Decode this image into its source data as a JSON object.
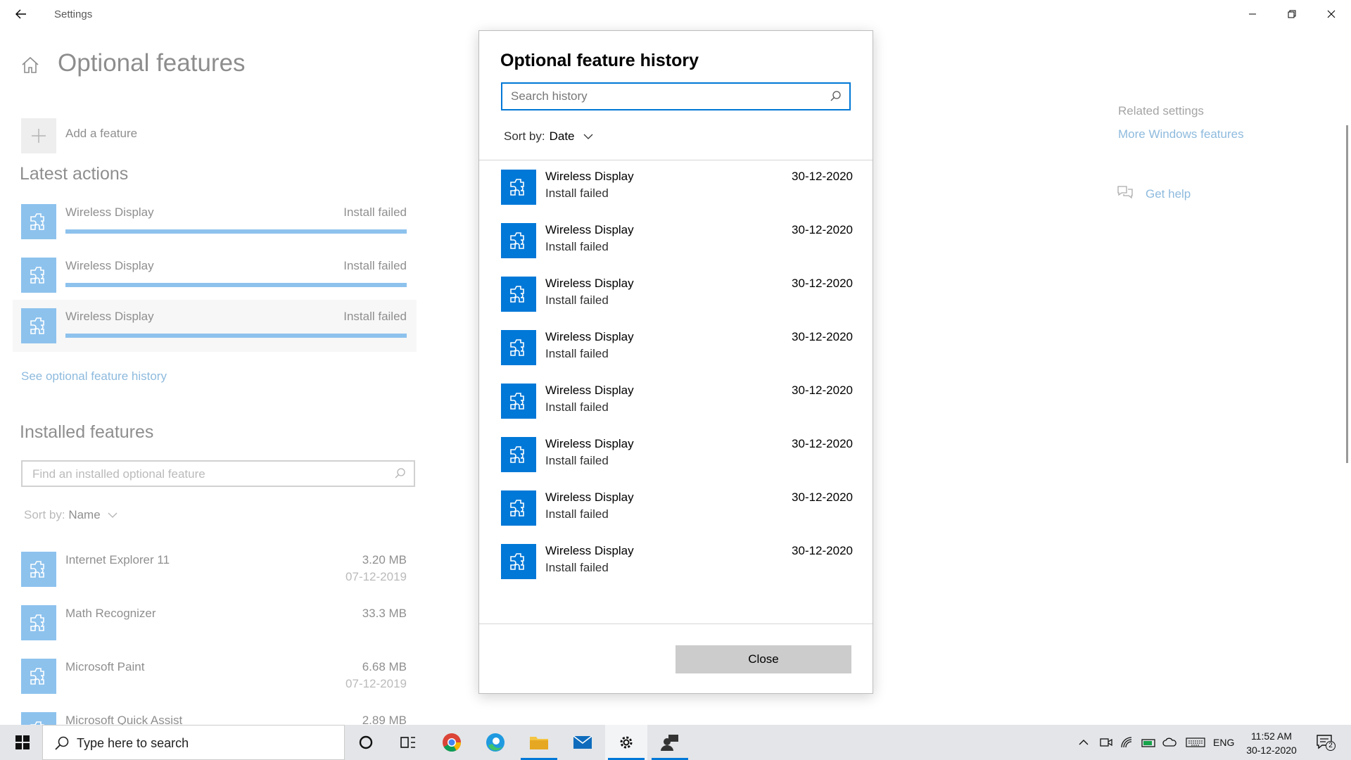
{
  "window": {
    "title": "Settings"
  },
  "page": {
    "title": "Optional features",
    "add_feature_label": "Add a feature",
    "latest_actions_heading": "Latest actions",
    "latest_actions": [
      {
        "name": "Wireless Display",
        "status": "Install failed",
        "progress": 1.0
      },
      {
        "name": "Wireless Display",
        "status": "Install failed",
        "progress": 1.0
      },
      {
        "name": "Wireless Display",
        "status": "Install failed",
        "progress": 1.0
      }
    ],
    "history_link": "See optional feature history",
    "installed_heading": "Installed features",
    "installed_search_placeholder": "Find an installed optional feature",
    "installed_sort_label": "Sort by:",
    "installed_sort_value": "Name",
    "installed": [
      {
        "name": "Internet Explorer 11",
        "size": "3.20 MB",
        "date": "07-12-2019"
      },
      {
        "name": "Math Recognizer",
        "size": "33.3 MB",
        "date": ""
      },
      {
        "name": "Microsoft Paint",
        "size": "6.68 MB",
        "date": "07-12-2019"
      },
      {
        "name": "Microsoft Quick Assist",
        "size": "2.89 MB",
        "date": ""
      }
    ],
    "related_heading": "Related settings",
    "related_link": "More Windows features",
    "help_link": "Get help"
  },
  "dialog": {
    "title": "Optional feature history",
    "search_placeholder": "Search history",
    "sort_label": "Sort by:",
    "sort_value": "Date",
    "history": [
      {
        "name": "Wireless Display",
        "status": "Install failed",
        "date": "30-12-2020"
      },
      {
        "name": "Wireless Display",
        "status": "Install failed",
        "date": "30-12-2020"
      },
      {
        "name": "Wireless Display",
        "status": "Install failed",
        "date": "30-12-2020"
      },
      {
        "name": "Wireless Display",
        "status": "Install failed",
        "date": "30-12-2020"
      },
      {
        "name": "Wireless Display",
        "status": "Install failed",
        "date": "30-12-2020"
      },
      {
        "name": "Wireless Display",
        "status": "Install failed",
        "date": "30-12-2020"
      },
      {
        "name": "Wireless Display",
        "status": "Install failed",
        "date": "30-12-2020"
      },
      {
        "name": "Wireless Display",
        "status": "Install failed",
        "date": "30-12-2020"
      }
    ],
    "close_label": "Close"
  },
  "taskbar": {
    "search_placeholder": "Type here to search",
    "apps": [
      "cortana-icon",
      "task-view-icon",
      "chrome-icon",
      "edge-icon",
      "file-explorer-icon",
      "mail-icon",
      "settings-icon",
      "people-app-icon"
    ],
    "language": "ENG",
    "time": "11:52 AM",
    "date": "30-12-2020",
    "notification_count": "2"
  },
  "colors": {
    "accent": "#0078d7",
    "link": "#0066b4",
    "taskbar_bg": "#e3e5e8"
  }
}
